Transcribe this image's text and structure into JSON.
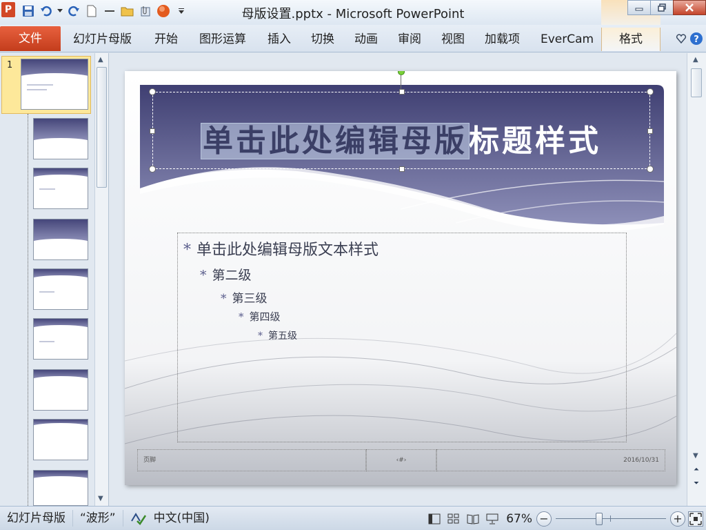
{
  "window": {
    "title": "母版设置.pptx - Microsoft PowerPoint",
    "app_icon_letter": "P"
  },
  "ribbon": {
    "tabs": [
      "幻灯片母版",
      "开始",
      "图形运算",
      "插入",
      "切换",
      "动画",
      "审阅",
      "视图",
      "加载项",
      "EverCam"
    ],
    "file_tab": "文件",
    "context_tab": "格式"
  },
  "thumbnails": {
    "selected_number": "1"
  },
  "slide": {
    "title_selected": "单击此处编辑母版",
    "title_rest": "标题样式",
    "bullets": [
      {
        "text": "单击此处编辑母版文本样式",
        "level": 1
      },
      {
        "text": "第二级",
        "level": 2
      },
      {
        "text": "第三级",
        "level": 3
      },
      {
        "text": "第四级",
        "level": 4
      },
      {
        "text": "第五级",
        "level": 5
      }
    ],
    "bullet_symbol": "*",
    "footer": {
      "left": "页脚",
      "center": "‹#›",
      "right": "2016/10/31"
    }
  },
  "statusbar": {
    "view_name": "幻灯片母版",
    "theme": "“波形”",
    "language": "中文(中国)",
    "zoom": "67%"
  },
  "colors": {
    "file_tab": "#d24726",
    "title_band": "#45467a",
    "selection_yellow": "#fde89a"
  }
}
